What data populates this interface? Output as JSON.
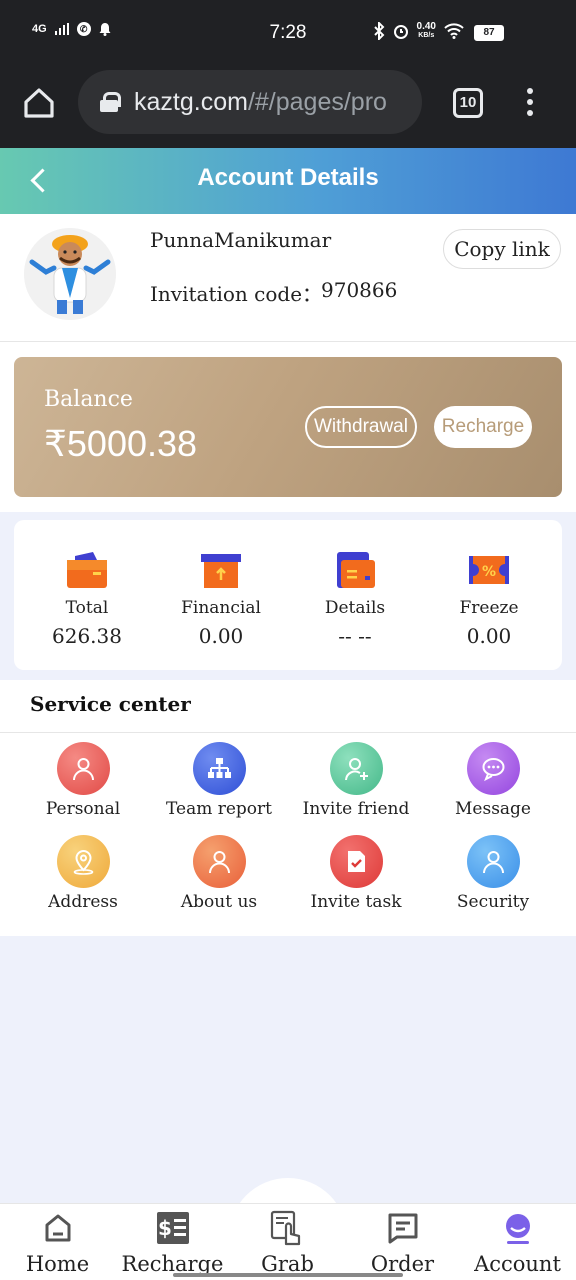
{
  "status_bar": {
    "time": "7:28",
    "network": "4G",
    "speed_value": "0.40",
    "speed_unit": "KB/s",
    "battery": "87"
  },
  "browser": {
    "url_main": "kaztg.com",
    "url_rest": "/#/pages/pro",
    "tab_count": "10"
  },
  "header": {
    "title": "Account Details"
  },
  "profile": {
    "username": "PunnaManikumar",
    "invitation_label": "Invitation code：",
    "invitation_code": "970866",
    "copy_link": "Copy link"
  },
  "balance": {
    "label": "Balance",
    "value": "₹5000.38",
    "withdrawal": "Withdrawal",
    "recharge": "Recharge"
  },
  "stats": [
    {
      "label": "Total",
      "value": "626.38",
      "icon": "wallet-icon"
    },
    {
      "label": "Financial",
      "value": "0.00",
      "icon": "box-arrow-icon"
    },
    {
      "label": "Details",
      "value": "-- --",
      "icon": "details-wallet-icon"
    },
    {
      "label": "Freeze",
      "value": "0.00",
      "icon": "coupon-icon"
    }
  ],
  "service": {
    "title": "Service center",
    "items": [
      {
        "label": "Personal",
        "icon": "person-icon",
        "color": "#ea5a57"
      },
      {
        "label": "Team report",
        "icon": "org-chart-icon",
        "color": "#3f64e0"
      },
      {
        "label": "Invite friend",
        "icon": "add-user-icon",
        "color": "#5cc79b"
      },
      {
        "label": "Message",
        "icon": "chat-bubble-icon",
        "color": "#a55de6"
      },
      {
        "label": "Address",
        "icon": "location-pin-icon",
        "color": "#f2b84e"
      },
      {
        "label": "About us",
        "icon": "person-icon",
        "color": "#ee7a4a"
      },
      {
        "label": "Invite task",
        "icon": "task-doc-icon",
        "color": "#e84a48"
      },
      {
        "label": "Security",
        "icon": "person-icon",
        "color": "#4a9ff0"
      }
    ]
  },
  "bottom_nav": [
    {
      "label": "Home",
      "icon": "home-icon"
    },
    {
      "label": "Recharge",
      "icon": "recharge-icon"
    },
    {
      "label": "Grab",
      "icon": "grab-hand-icon"
    },
    {
      "label": "Order",
      "icon": "order-icon"
    },
    {
      "label": "Account",
      "icon": "account-icon",
      "active_color": "#7b61e8"
    }
  ]
}
